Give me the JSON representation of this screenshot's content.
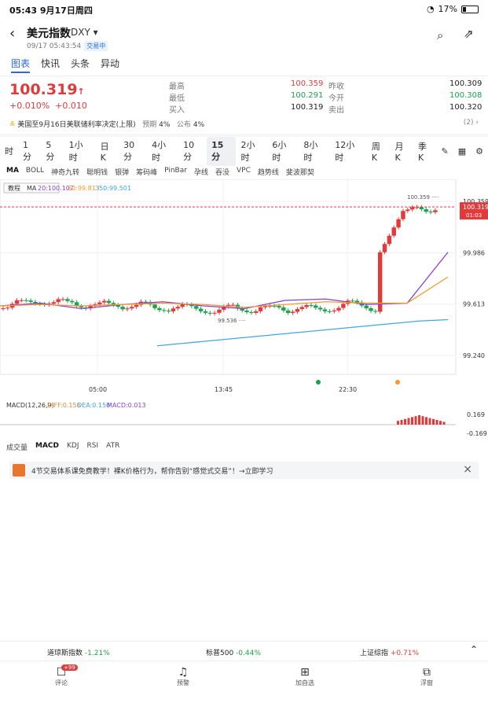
{
  "status": {
    "time": "05:43",
    "date": "9月17日周四",
    "battery": "17%"
  },
  "header": {
    "title": "美元指数",
    "code": "DXY",
    "datetime": "09/17 05:43:54",
    "state": "交易中"
  },
  "tabs": [
    "图表",
    "快讯",
    "头条",
    "异动"
  ],
  "quote": {
    "price": "100.319",
    "change": "+0.010%",
    "change_abs": "+0.010",
    "high_label": "最高",
    "high": "100.359",
    "low_label": "最低",
    "low": "100.291",
    "buy_label": "买入",
    "buy": "100.319",
    "prev_label": "昨收",
    "prev": "100.309",
    "open_label": "今开",
    "open": "100.308",
    "sell_label": "卖出",
    "sell": "100.320"
  },
  "event": {
    "text": "美国至9月16日美联储利率决定(上限)",
    "expect_label": "预期",
    "expect": "4%",
    "pub_label": "公布",
    "pub": "4%",
    "count": "(2)"
  },
  "periods": [
    "时",
    "1分",
    "5分",
    "1小时",
    "日K",
    "30分",
    "4小时",
    "10分",
    "15分",
    "2小时",
    "6小时",
    "8小时",
    "12小时",
    "周K",
    "月K",
    "季K"
  ],
  "indicators": [
    "MA",
    "BOLL",
    "神奇九转",
    "聪明钱",
    "银弹",
    "筹码峰",
    "PinBar",
    "孕线",
    "吞没",
    "VPC",
    "趋势线",
    "斐波那契"
  ],
  "ma_legend": {
    "tag": "教程",
    "label": "MA",
    "ma20": "20:100.107",
    "ma60": "60:99.813",
    "ma350": "350:99.501"
  },
  "macd_legend": {
    "label": "MACD(12,26,9)",
    "diff": "DIFF:0.156",
    "dea": "DEA:0.150",
    "macd": "MACD:0.013"
  },
  "lower_tabs": [
    "成交量",
    "MACD",
    "KDJ",
    "RSI",
    "ATR"
  ],
  "promo": {
    "text": "4节交易体系课免费教学！裸K价格行为，帮你告别“感觉式交易”！→立即学习"
  },
  "ticker": [
    {
      "name": "道琼斯指数",
      "value": "-1.21%"
    },
    {
      "name": "标普500",
      "value": "-0.44%"
    },
    {
      "name": "上证综指",
      "value": "+0.71%"
    }
  ],
  "nav": {
    "comment": "评论",
    "badge": "+99",
    "alert": "预警",
    "watch": "加自选",
    "float": "浮窗"
  },
  "chart_data": {
    "type": "line",
    "title": "",
    "xlabel": "",
    "ylabel": "",
    "x": [
      "05:00",
      "13:45",
      "22:30"
    ],
    "y_ticks": [
      "100.359",
      "99.986",
      "99.613",
      "99.240"
    ],
    "ylim": [
      99.24,
      100.36
    ],
    "annotations": [
      "100.359",
      "99.536",
      "100.319",
      "01:03"
    ],
    "macd_ticks": [
      "0.169",
      "-0.169"
    ],
    "series": [
      {
        "name": "MA20",
        "values": [
          99.6,
          99.62,
          99.58,
          99.61,
          99.63,
          99.6,
          99.58,
          99.64,
          99.65,
          99.61,
          99.62,
          99.99
        ]
      },
      {
        "name": "MA60",
        "values": [
          99.6,
          99.61,
          99.6,
          99.61,
          99.62,
          99.61,
          99.59,
          99.61,
          99.63,
          99.62,
          99.62,
          99.81
        ]
      },
      {
        "name": "MA350",
        "values": [
          99.31,
          99.33,
          99.35,
          99.37,
          99.39,
          99.41,
          99.43,
          99.45,
          99.47,
          99.49,
          99.5
        ]
      }
    ],
    "colors": {
      "up": "#e23a3a",
      "down": "#1aa34a",
      "ma20": "#8a3fd6",
      "ma60": "#f39a2e",
      "ma350": "#3fa7e0"
    }
  }
}
